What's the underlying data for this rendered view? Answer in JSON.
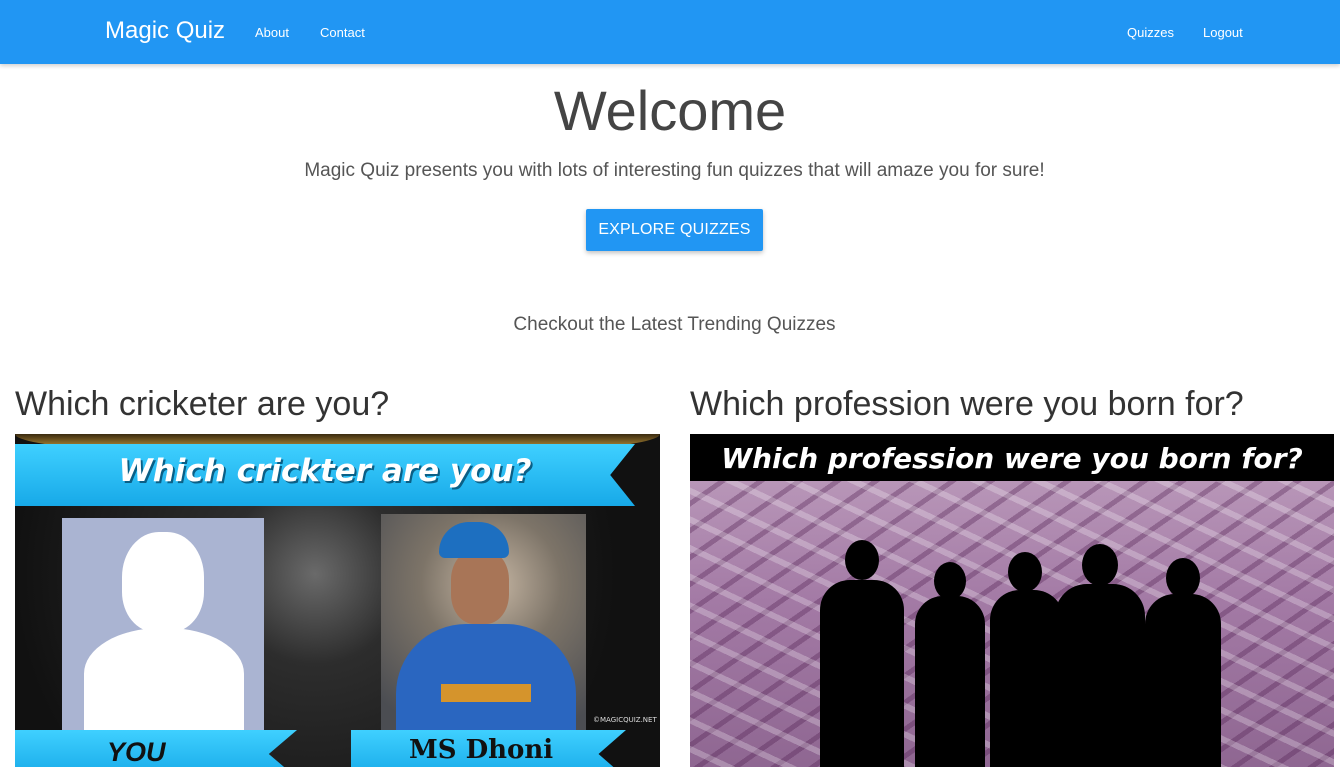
{
  "navbar": {
    "brand": "Magic Quiz",
    "links_left": [
      "About",
      "Contact"
    ],
    "links_right": [
      "Quizzes",
      "Logout"
    ],
    "background_color": "#2196f3"
  },
  "hero": {
    "title": "Welcome",
    "tagline": "Magic Quiz presents you with lots of interesting fun quizzes that will amaze you for sure!",
    "button_label": "EXPLORE QUIZZES"
  },
  "trending": {
    "heading": "Checkout the Latest Trending Quizzes"
  },
  "cards": [
    {
      "title": "Which cricketer are you?",
      "image": {
        "banner_text": "Which crickter are you?",
        "label_left": "YOU",
        "label_right": "MS Dhoni",
        "watermark": "©MAGICQUIZ.NET"
      }
    },
    {
      "title": "Which profession were you born for?",
      "image": {
        "banner_text": "Which profession were you born for?"
      }
    }
  ]
}
